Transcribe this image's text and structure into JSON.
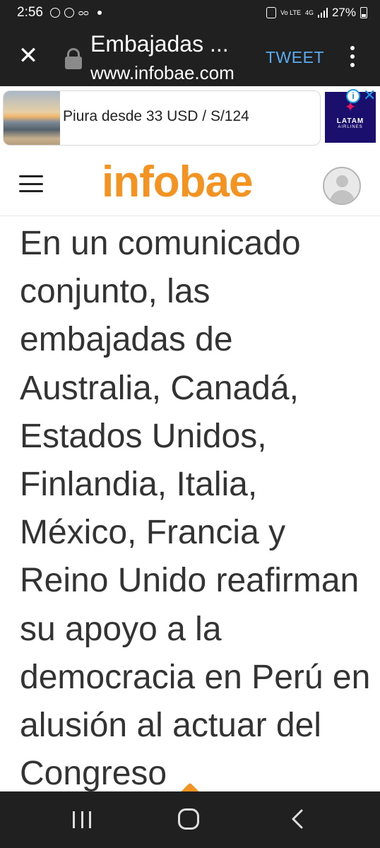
{
  "status_bar": {
    "time": "2:56",
    "network": "4G",
    "volte": "Vo LTE",
    "battery": "27%",
    "icons": [
      "rpp-app-icon",
      "vpn-icon",
      "voicemail-icon",
      "notification-dot",
      "alarm-icon",
      "signal-icon",
      "battery-icon"
    ]
  },
  "browser_bar": {
    "title": "Embajadas ...",
    "url": "www.infobae.com",
    "tweet_label": "TWEET"
  },
  "ad": {
    "text": "Piura desde 33 USD / S/124",
    "brand": "LATAM",
    "brand_sub": "AIRLINES",
    "info_label": "i",
    "close_label": "✕"
  },
  "site_header": {
    "logo": "infobae",
    "logo_color": "#f39322"
  },
  "article": {
    "body": "En un comunicado conjunto, las embajadas de Australia, Canadá, Estados Unidos, Finlandia, Italia, México, Francia y Reino Unido reafirman su apoyo a la democracia en Perú en alusión al actuar del Congreso"
  },
  "colors": {
    "accent": "#f39322",
    "tweet": "#5aaaf0",
    "chrome_bg": "#202020"
  }
}
